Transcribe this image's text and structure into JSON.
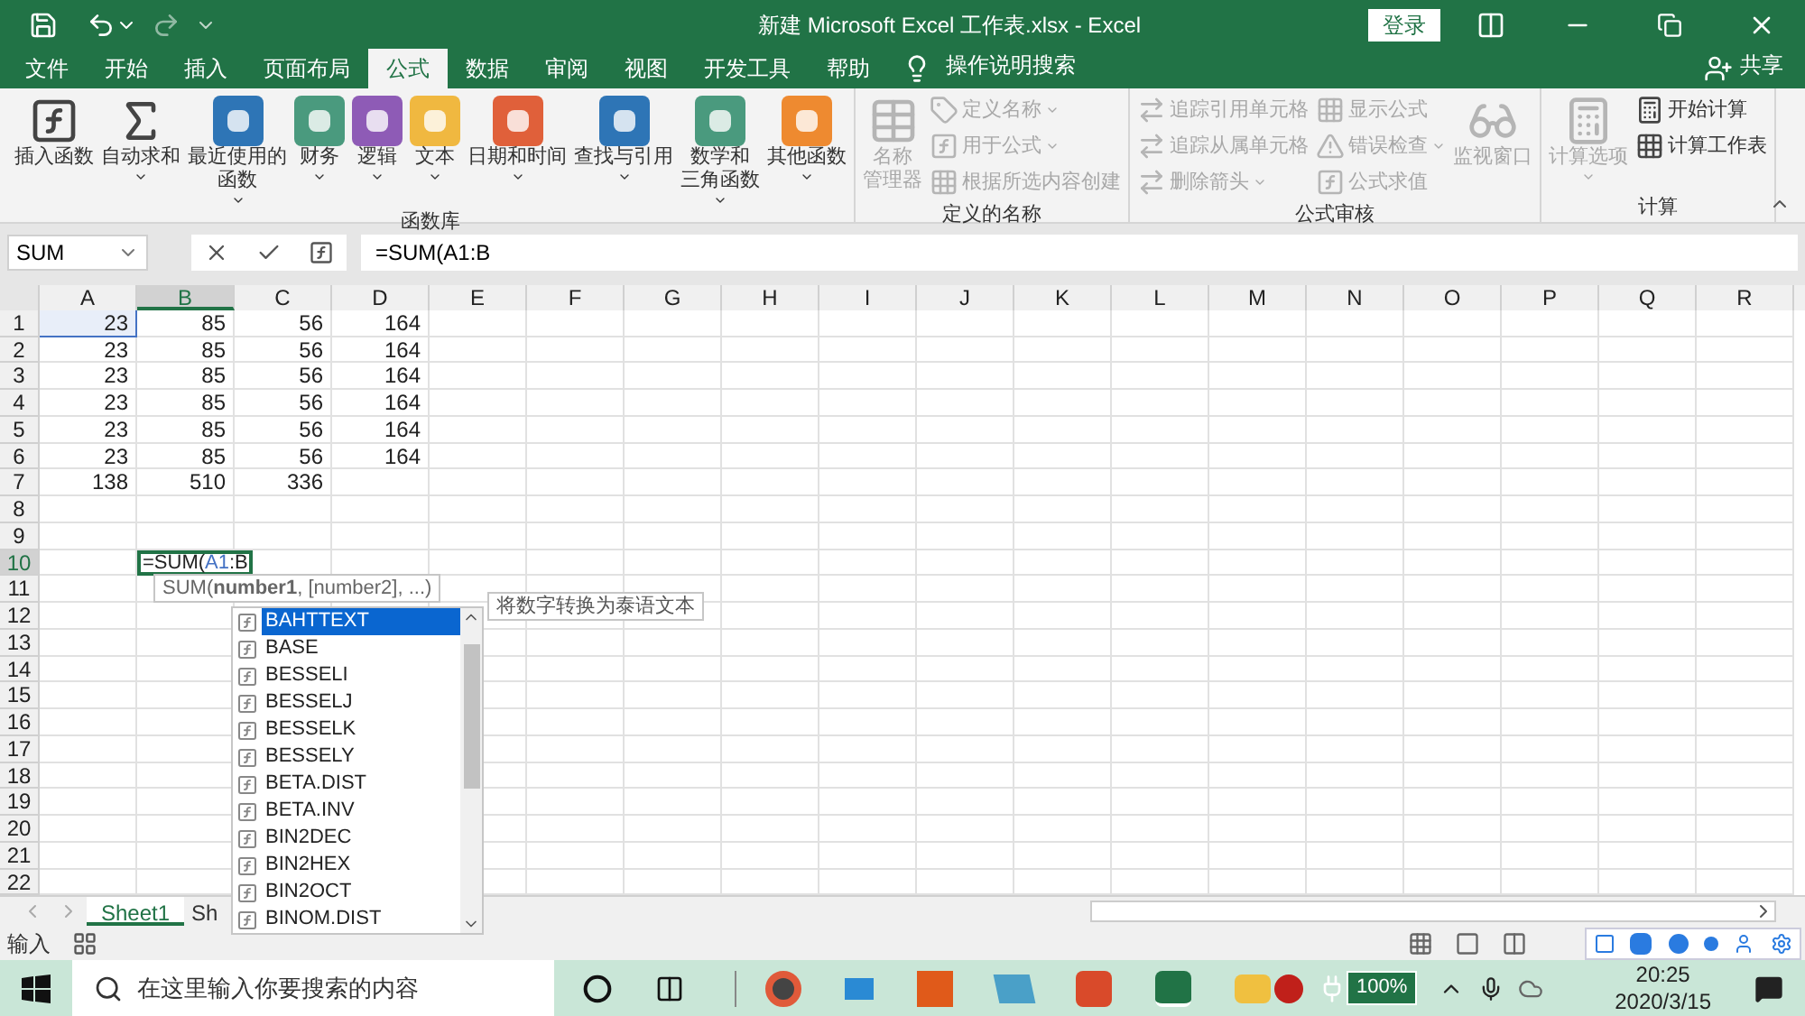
{
  "title_bar": {
    "title": "新建 Microsoft Excel 工作表.xlsx - Excel",
    "login": "登录"
  },
  "menu_tabs": [
    {
      "label": "文件",
      "selected": false
    },
    {
      "label": "开始",
      "selected": false
    },
    {
      "label": "插入",
      "selected": false
    },
    {
      "label": "页面布局",
      "selected": false
    },
    {
      "label": "公式",
      "selected": true
    },
    {
      "label": "数据",
      "selected": false
    },
    {
      "label": "审阅",
      "selected": false
    },
    {
      "label": "视图",
      "selected": false
    },
    {
      "label": "开发工具",
      "selected": false
    },
    {
      "label": "帮助",
      "selected": false
    }
  ],
  "tell_me": "操作说明搜索",
  "share": "共享",
  "ribbon_groups": [
    {
      "label": "函数库",
      "buttons": [
        {
          "kind": "big",
          "lines": [
            "插入函数"
          ],
          "dropdown": false,
          "disabled": false
        },
        {
          "kind": "big",
          "lines": [
            "自动求和"
          ],
          "dropdown": true,
          "disabled": false
        },
        {
          "kind": "big",
          "lines": [
            "最近使用的",
            "函数"
          ],
          "dropdown": true,
          "disabled": false
        },
        {
          "kind": "big",
          "lines": [
            "财务"
          ],
          "dropdown": true,
          "disabled": false
        },
        {
          "kind": "big",
          "lines": [
            "逻辑"
          ],
          "dropdown": true,
          "disabled": false
        },
        {
          "kind": "big",
          "lines": [
            "文本"
          ],
          "dropdown": true,
          "disabled": false
        },
        {
          "kind": "big",
          "lines": [
            "日期和时间"
          ],
          "dropdown": true,
          "disabled": false
        },
        {
          "kind": "big",
          "lines": [
            "查找与引用"
          ],
          "dropdown": true,
          "disabled": false
        },
        {
          "kind": "big",
          "lines": [
            "数学和",
            "三角函数"
          ],
          "dropdown": true,
          "disabled": false
        },
        {
          "kind": "big",
          "lines": [
            "其他函数"
          ],
          "dropdown": true,
          "disabled": false
        }
      ]
    },
    {
      "label": "定义的名称",
      "buttons": [
        {
          "kind": "big",
          "lines": [
            "名称",
            "管理器"
          ],
          "dropdown": false,
          "disabled": true
        },
        {
          "kind": "small",
          "lines": [
            "定义名称"
          ],
          "dropdown": true,
          "disabled": true
        },
        {
          "kind": "small",
          "lines": [
            "用于公式"
          ],
          "dropdown": true,
          "disabled": true
        },
        {
          "kind": "small",
          "lines": [
            "根据所选内容创建"
          ],
          "dropdown": false,
          "disabled": true
        }
      ]
    },
    {
      "label": "公式审核",
      "buttons": [
        {
          "kind": "small",
          "lines": [
            "追踪引用单元格"
          ],
          "dropdown": false,
          "disabled": true
        },
        {
          "kind": "small",
          "lines": [
            "追踪从属单元格"
          ],
          "dropdown": false,
          "disabled": true
        },
        {
          "kind": "small",
          "lines": [
            "删除箭头"
          ],
          "dropdown": true,
          "disabled": true
        },
        {
          "kind": "small",
          "lines": [
            "显示公式"
          ],
          "dropdown": false,
          "disabled": true
        },
        {
          "kind": "small",
          "lines": [
            "错误检查"
          ],
          "dropdown": true,
          "disabled": true
        },
        {
          "kind": "small",
          "lines": [
            "公式求值"
          ],
          "dropdown": false,
          "disabled": true
        },
        {
          "kind": "big",
          "lines": [
            "监视窗口"
          ],
          "dropdown": false,
          "disabled": true
        }
      ]
    },
    {
      "label": "计算",
      "buttons": [
        {
          "kind": "big",
          "lines": [
            "计算选项"
          ],
          "dropdown": true,
          "disabled": true
        },
        {
          "kind": "small",
          "lines": [
            "开始计算"
          ],
          "dropdown": false,
          "disabled": false
        },
        {
          "kind": "small",
          "lines": [
            "计算工作表"
          ],
          "dropdown": false,
          "disabled": false
        }
      ]
    }
  ],
  "formula_bar": {
    "name_box": "SUM",
    "formula": "=SUM(A1:B"
  },
  "columns": [
    {
      "label": "A",
      "selected": false
    },
    {
      "label": "B",
      "selected": true
    },
    {
      "label": "C",
      "selected": false
    },
    {
      "label": "D",
      "selected": false
    },
    {
      "label": "E",
      "selected": false
    },
    {
      "label": "F",
      "selected": false
    },
    {
      "label": "G",
      "selected": false
    },
    {
      "label": "H",
      "selected": false
    },
    {
      "label": "I",
      "selected": false
    },
    {
      "label": "J",
      "selected": false
    },
    {
      "label": "K",
      "selected": false
    },
    {
      "label": "L",
      "selected": false
    },
    {
      "label": "M",
      "selected": false
    },
    {
      "label": "N",
      "selected": false
    },
    {
      "label": "O",
      "selected": false
    },
    {
      "label": "P",
      "selected": false
    },
    {
      "label": "Q",
      "selected": false
    },
    {
      "label": "R",
      "selected": false
    }
  ],
  "rows": [
    {
      "label": "1",
      "selected": false,
      "cells": [
        {
          "text": "23",
          "selected": true
        },
        {
          "text": "85",
          "selected": false
        },
        {
          "text": "56",
          "selected": false
        },
        {
          "text": "164",
          "selected": false
        }
      ]
    },
    {
      "label": "2",
      "selected": false,
      "cells": [
        {
          "text": "23",
          "selected": false
        },
        {
          "text": "85",
          "selected": false
        },
        {
          "text": "56",
          "selected": false
        },
        {
          "text": "164",
          "selected": false
        }
      ]
    },
    {
      "label": "3",
      "selected": false,
      "cells": [
        {
          "text": "23",
          "selected": false
        },
        {
          "text": "85",
          "selected": false
        },
        {
          "text": "56",
          "selected": false
        },
        {
          "text": "164",
          "selected": false
        }
      ]
    },
    {
      "label": "4",
      "selected": false,
      "cells": [
        {
          "text": "23",
          "selected": false
        },
        {
          "text": "85",
          "selected": false
        },
        {
          "text": "56",
          "selected": false
        },
        {
          "text": "164",
          "selected": false
        }
      ]
    },
    {
      "label": "5",
      "selected": false,
      "cells": [
        {
          "text": "23",
          "selected": false
        },
        {
          "text": "85",
          "selected": false
        },
        {
          "text": "56",
          "selected": false
        },
        {
          "text": "164",
          "selected": false
        }
      ]
    },
    {
      "label": "6",
      "selected": false,
      "cells": [
        {
          "text": "23",
          "selected": false
        },
        {
          "text": "85",
          "selected": false
        },
        {
          "text": "56",
          "selected": false
        },
        {
          "text": "164",
          "selected": false
        }
      ]
    },
    {
      "label": "7",
      "selected": false,
      "cells": [
        {
          "text": "138",
          "selected": false
        },
        {
          "text": "510",
          "selected": false
        },
        {
          "text": "336",
          "selected": false
        }
      ]
    },
    {
      "label": "8",
      "selected": false,
      "cells": []
    },
    {
      "label": "9",
      "selected": false,
      "cells": []
    },
    {
      "label": "10",
      "selected": true,
      "cells": [],
      "edit_parts": [
        {
          "text": "=SUM(",
          "kind": "plain"
        },
        {
          "text": "A1",
          "kind": "ref"
        },
        {
          "text": ":B",
          "kind": "plain"
        }
      ]
    },
    {
      "label": "11",
      "selected": false,
      "cells": []
    },
    {
      "label": "12",
      "selected": false,
      "cells": []
    },
    {
      "label": "13",
      "selected": false,
      "cells": []
    },
    {
      "label": "14",
      "selected": false,
      "cells": []
    },
    {
      "label": "15",
      "selected": false,
      "cells": []
    },
    {
      "label": "16",
      "selected": false,
      "cells": []
    },
    {
      "label": "17",
      "selected": false,
      "cells": []
    },
    {
      "label": "18",
      "selected": false,
      "cells": []
    },
    {
      "label": "19",
      "selected": false,
      "cells": []
    },
    {
      "label": "20",
      "selected": false,
      "cells": []
    },
    {
      "label": "21",
      "selected": false,
      "cells": []
    },
    {
      "label": "22",
      "selected": false,
      "cells": []
    }
  ],
  "syntax_tip": "SUM(**number1**, [number2], ...)",
  "autocomplete": {
    "items": [
      {
        "label": "BAHTTEXT",
        "selected": true
      },
      {
        "label": "BASE",
        "selected": false
      },
      {
        "label": "BESSELI",
        "selected": false
      },
      {
        "label": "BESSELJ",
        "selected": false
      },
      {
        "label": "BESSELK",
        "selected": false
      },
      {
        "label": "BESSELY",
        "selected": false
      },
      {
        "label": "BETA.DIST",
        "selected": false
      },
      {
        "label": "BETA.INV",
        "selected": false
      },
      {
        "label": "BIN2DEC",
        "selected": false
      },
      {
        "label": "BIN2HEX",
        "selected": false
      },
      {
        "label": "BIN2OCT",
        "selected": false
      },
      {
        "label": "BINOM.DIST",
        "selected": false
      }
    ],
    "description": "将数字转换为泰语文本"
  },
  "sheet_tabs": [
    {
      "label": "Sheet1",
      "selected": true
    },
    {
      "label": "Sh",
      "selected": false
    }
  ],
  "status_bar": {
    "mode": "输入"
  },
  "taskbar": {
    "search_placeholder": "在这里输入你要搜索的内容",
    "battery": "100%",
    "time": "20:25",
    "date": "2020/3/15"
  }
}
